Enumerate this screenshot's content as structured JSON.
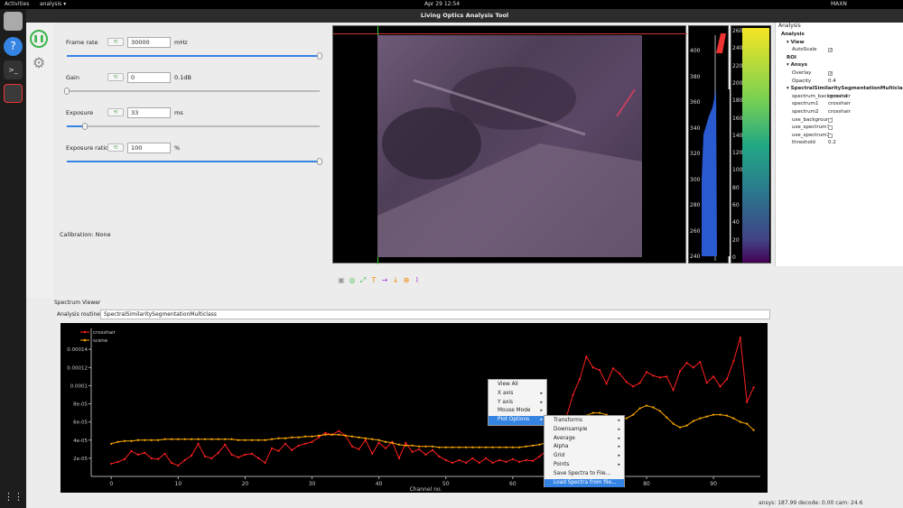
{
  "topbar": {
    "activities": "Activities",
    "app": "analysis ▾",
    "clock": "Apr 29  12:54",
    "tray": "MAXN"
  },
  "window": {
    "title": "Living Optics Analysis Tool"
  },
  "controls": [
    {
      "label": "Frame rate",
      "value": "30000",
      "unit": "mHz",
      "level": 1.0
    },
    {
      "label": "Gain",
      "value": "0",
      "unit": "0.1dB",
      "level": 0.0
    },
    {
      "label": "Exposure",
      "value": "33",
      "unit": "ms",
      "level": 0.07
    },
    {
      "label": "Exposure ratio",
      "value": "100",
      "unit": "%",
      "level": 1.0
    }
  ],
  "calibration": "Calibration: None",
  "hist1_ticks": [
    "400",
    "380",
    "360",
    "340",
    "320",
    "300",
    "280",
    "260",
    "240"
  ],
  "hist2_ticks": [
    "260",
    "240",
    "220",
    "200",
    "180",
    "160",
    "140",
    "120",
    "100",
    "80",
    "60",
    "40",
    "20",
    "0"
  ],
  "analysis_panel": {
    "title": "Analysis",
    "rows": [
      {
        "k": "Analysis",
        "v": "",
        "type": "header",
        "indent": 1
      },
      {
        "k": "▾ View",
        "v": "",
        "type": "header",
        "indent": 2
      },
      {
        "k": "AutoScale",
        "v": "✓",
        "type": "check",
        "indent": 3
      },
      {
        "k": "ROI",
        "v": "",
        "type": "header",
        "indent": 2
      },
      {
        "k": "▾ Ansys",
        "v": "",
        "type": "header",
        "indent": 2
      },
      {
        "k": "Overlay",
        "v": "✓",
        "type": "check",
        "indent": 3
      },
      {
        "k": "Opacity",
        "v": "0.4",
        "type": "value",
        "indent": 3
      },
      {
        "k": "▾ SpectralSimilaritySegmentationMulticlass",
        "v": "",
        "type": "header",
        "indent": 2
      },
      {
        "k": "spectrum_background",
        "v": "crosshair",
        "type": "value",
        "indent": 3
      },
      {
        "k": "spectrum1",
        "v": "crosshair",
        "type": "value",
        "indent": 3
      },
      {
        "k": "spectrum2",
        "v": "crosshair",
        "type": "value",
        "indent": 3
      },
      {
        "k": "use_background",
        "v": "",
        "type": "check",
        "indent": 3
      },
      {
        "k": "use_spectrum1",
        "v": "",
        "type": "check",
        "indent": 3
      },
      {
        "k": "use_spectrum2",
        "v": "",
        "type": "check",
        "indent": 3
      },
      {
        "k": "threshold",
        "v": "0.2",
        "type": "value",
        "indent": 3
      }
    ]
  },
  "spectrum_viewer": {
    "title": "Spectrum Viewer",
    "routine_label": "Analysis routine:",
    "routine_value": "SpectralSimilaritySegmentationMulticlass"
  },
  "context_menu": {
    "items": [
      "View All",
      "X axis",
      "Y axis",
      "Mouse Mode",
      "Plot Options"
    ],
    "submenu": [
      "Transforms",
      "Downsample",
      "Average",
      "Alpha",
      "Grid",
      "Points",
      "Save Spectra to File...",
      "Load Spectra from file..."
    ]
  },
  "status": "ansys: 187.99 decode: 0.00 cam: 24.6",
  "chart_data": {
    "type": "line",
    "xlabel": "Channel no.",
    "ylabel": "",
    "xlim": [
      -3,
      97
    ],
    "ylim": [
      0,
      0.000163
    ],
    "x_ticks": [
      "0",
      "10",
      "20",
      "30",
      "40",
      "50",
      "60",
      "70",
      "80",
      "90"
    ],
    "y_ticks": [
      "2e-05",
      "4e-05",
      "6e-05",
      "8e-05",
      "0.0001",
      "0.00012",
      "0.00014"
    ],
    "series": [
      {
        "name": "crosshair",
        "color": "#ff2020",
        "values": [
          1.4e-05,
          1.6e-05,
          1.9e-05,
          2.8e-05,
          2.4e-05,
          2.6e-05,
          2e-05,
          1.9e-05,
          2.5e-05,
          1.5e-05,
          1.2e-05,
          1.8e-05,
          2.3e-05,
          3.6e-05,
          2.2e-05,
          2e-05,
          2.6e-05,
          3.5e-05,
          2.4e-05,
          2.1e-05,
          2.4e-05,
          2.5e-05,
          2e-05,
          1.5e-05,
          3.1e-05,
          2.8e-05,
          3.6e-05,
          2.9e-05,
          3.4e-05,
          3.6e-05,
          3.8e-05,
          4.3e-05,
          4.8e-05,
          4.6e-05,
          5e-05,
          4.5e-05,
          3.3e-05,
          3e-05,
          4e-05,
          2.5e-05,
          3.7e-05,
          3.1e-05,
          3.8e-05,
          2e-05,
          3.7e-05,
          2.7e-05,
          3e-05,
          2.4e-05,
          2.9e-05,
          2.2e-05,
          1.8e-05,
          1.5e-05,
          1.8e-05,
          1.5e-05,
          2e-05,
          1.5e-05,
          2e-05,
          1.5e-05,
          1.8e-05,
          1.6e-05,
          1.9e-05,
          1.6e-05,
          1.8e-05,
          1.7e-05,
          2.2e-05,
          2.8e-05,
          2.9e-05,
          4.1e-05,
          6.5e-05,
          9e-05,
          0.000107,
          0.000132,
          0.00012,
          0.000117,
          0.000102,
          0.000119,
          0.000113,
          0.000104,
          9.9e-05,
          0.000103,
          0.000115,
          0.000111,
          0.000109,
          0.00011,
          9.5e-05,
          0.000116,
          0.000125,
          0.00012,
          0.000126,
          0.000103,
          0.00011,
          9.9e-05,
          0.000107,
          0.000127,
          0.000153,
          8.2e-05,
          9.8e-05
        ]
      },
      {
        "name": "scene",
        "color": "#ffaa00",
        "values": [
          3.6e-05,
          3.8e-05,
          3.9e-05,
          3.9e-05,
          4e-05,
          4e-05,
          4e-05,
          4e-05,
          4.1e-05,
          4.1e-05,
          4.1e-05,
          4.1e-05,
          4.1e-05,
          4.1e-05,
          4.1e-05,
          4.1e-05,
          4.1e-05,
          4.1e-05,
          4.1e-05,
          4e-05,
          4e-05,
          4e-05,
          4e-05,
          4e-05,
          4.1e-05,
          4.2e-05,
          4.2e-05,
          4.3e-05,
          4.3e-05,
          4.4e-05,
          4.4e-05,
          4.5e-05,
          4.6e-05,
          4.6e-05,
          4.6e-05,
          4.5e-05,
          4.4e-05,
          4.3e-05,
          4.2e-05,
          4.1e-05,
          4e-05,
          3.8e-05,
          3.7e-05,
          3.5e-05,
          3.4e-05,
          3.4e-05,
          3.3e-05,
          3.3e-05,
          3.3e-05,
          3.2e-05,
          3.2e-05,
          3.2e-05,
          3.2e-05,
          3.2e-05,
          3.2e-05,
          3.2e-05,
          3.2e-05,
          3.2e-05,
          3.2e-05,
          3.2e-05,
          3.2e-05,
          3.2e-05,
          3.3e-05,
          3.4e-05,
          3.5e-05,
          3.7e-05,
          4e-05,
          4.4e-05,
          5e-05,
          5.7e-05,
          6.2e-05,
          6.7e-05,
          7e-05,
          7e-05,
          6.8e-05,
          6.5e-05,
          6.3e-05,
          6.4e-05,
          6.8e-05,
          7.5e-05,
          7.8e-05,
          7.6e-05,
          7.2e-05,
          6.5e-05,
          5.8e-05,
          5.4e-05,
          5.6e-05,
          6.1e-05,
          6.4e-05,
          6.6e-05,
          6.8e-05,
          6.8e-05,
          6.7e-05,
          6.4e-05,
          6e-05,
          5.8e-05,
          5.1e-05
        ]
      }
    ]
  }
}
